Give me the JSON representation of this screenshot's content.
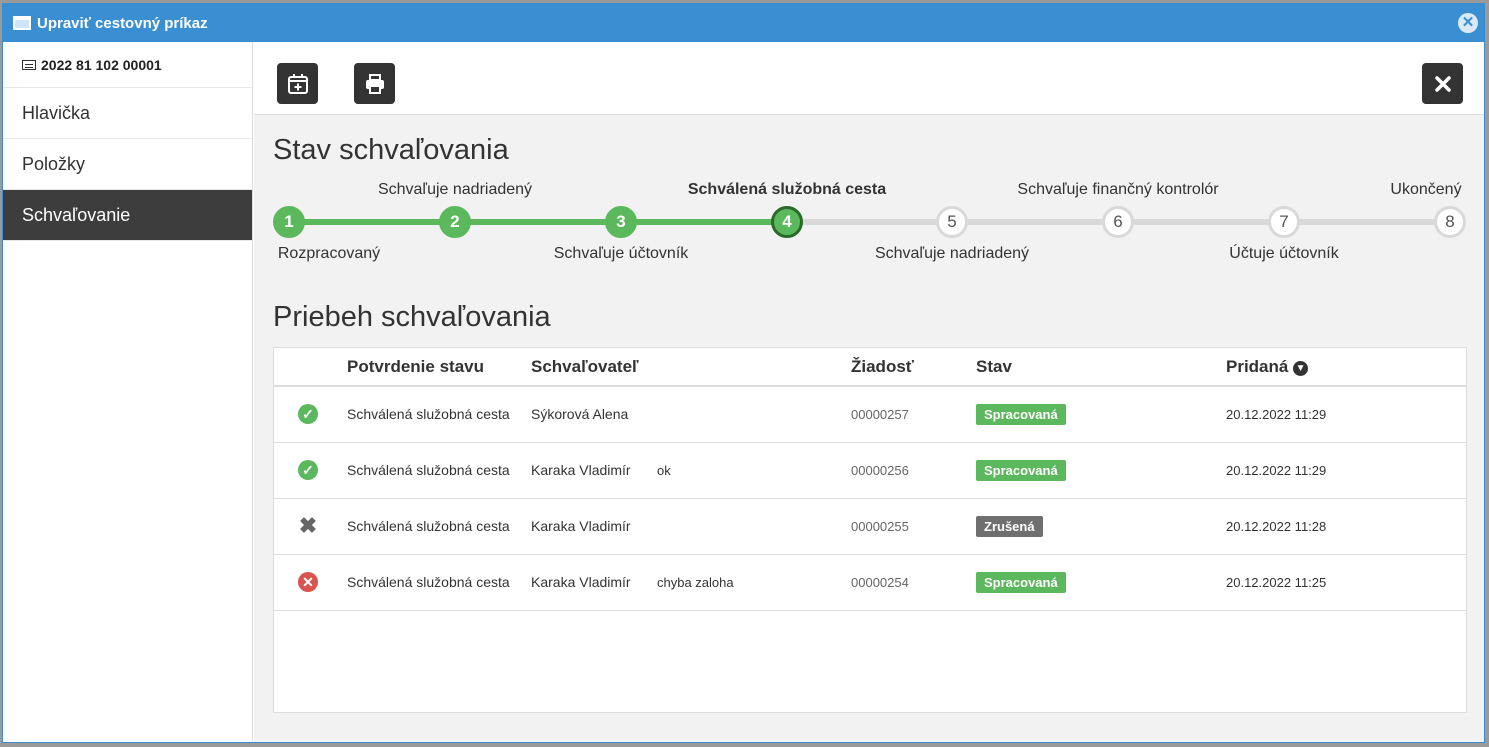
{
  "window": {
    "title": "Upraviť cestovný príkaz"
  },
  "sidebar": {
    "doc_id": "2022 81 102 00001",
    "items": [
      {
        "label": "Hlavička"
      },
      {
        "label": "Položky"
      },
      {
        "label": "Schvaľovanie",
        "active": true
      }
    ]
  },
  "toolbar": {
    "icons": [
      "calendar-plus-icon",
      "print-icon",
      "close-icon"
    ]
  },
  "approval_status": {
    "title": "Stav schvaľovania",
    "current_step": 4,
    "steps": [
      {
        "number": "1",
        "label": "Rozpracovaný"
      },
      {
        "number": "2",
        "label": "Schvaľuje nadriadený"
      },
      {
        "number": "3",
        "label": "Schvaľuje účtovník"
      },
      {
        "number": "4",
        "label": "Schválená služobná cesta"
      },
      {
        "number": "5",
        "label": "Schvaľuje nadriadený"
      },
      {
        "number": "6",
        "label": "Schvaľuje finančný kontrolór"
      },
      {
        "number": "7",
        "label": "Účtuje účtovník"
      },
      {
        "number": "8",
        "label": "Ukončený"
      }
    ]
  },
  "history": {
    "title": "Priebeh schvaľovania",
    "columns": [
      "Potvrdenie stavu",
      "Schvaľovateľ",
      "Žiadosť",
      "Stav",
      "Pridaná"
    ],
    "rows": [
      {
        "icon": "check-circle-icon",
        "status_confirm": "Schválená služobná cesta",
        "approver": "Sýkorová Alena",
        "note": "",
        "request": "00000257",
        "state": "Spracovaná",
        "state_color": "#5cb85c",
        "added": "20.12.2022 11:29"
      },
      {
        "icon": "check-circle-icon",
        "status_confirm": "Schválená služobná cesta",
        "approver": "Karaka Vladimír",
        "note": "ok",
        "request": "00000256",
        "state": "Spracovaná",
        "state_color": "#5cb85c",
        "added": "20.12.2022 11:29"
      },
      {
        "icon": "cross-icon",
        "status_confirm": "Schválená služobná cesta",
        "approver": "Karaka Vladimír",
        "note": "",
        "request": "00000255",
        "state": "Zrušená",
        "state_color": "#6f6f6f",
        "added": "20.12.2022 11:28"
      },
      {
        "icon": "error-circle-icon",
        "status_confirm": "Schválená služobná cesta",
        "approver": "Karaka Vladimír",
        "note": "chyba zaloha",
        "request": "00000254",
        "state": "Spracovaná",
        "state_color": "#5cb85c",
        "added": "20.12.2022 11:25"
      }
    ]
  },
  "colors": {
    "titlebar": "#3a8fd3",
    "step_done": "#5cb85c",
    "step_todo": "#d9d9d9",
    "sidebar_active": "#3d3d3d"
  }
}
